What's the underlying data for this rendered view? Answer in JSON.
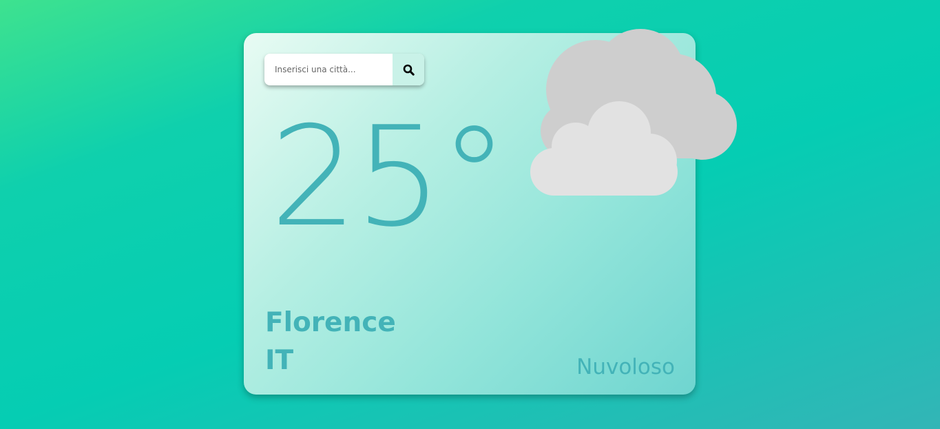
{
  "search": {
    "placeholder": "Inserisci una città..."
  },
  "weather": {
    "temperature": "25°",
    "city": "Florence",
    "country": "IT",
    "condition": "Nuvoloso",
    "icon": "cloudy-icon"
  },
  "colors": {
    "text_accent": "#43b3b8",
    "cloud_back": "#cecece",
    "cloud_front": "#e2e2e2"
  }
}
